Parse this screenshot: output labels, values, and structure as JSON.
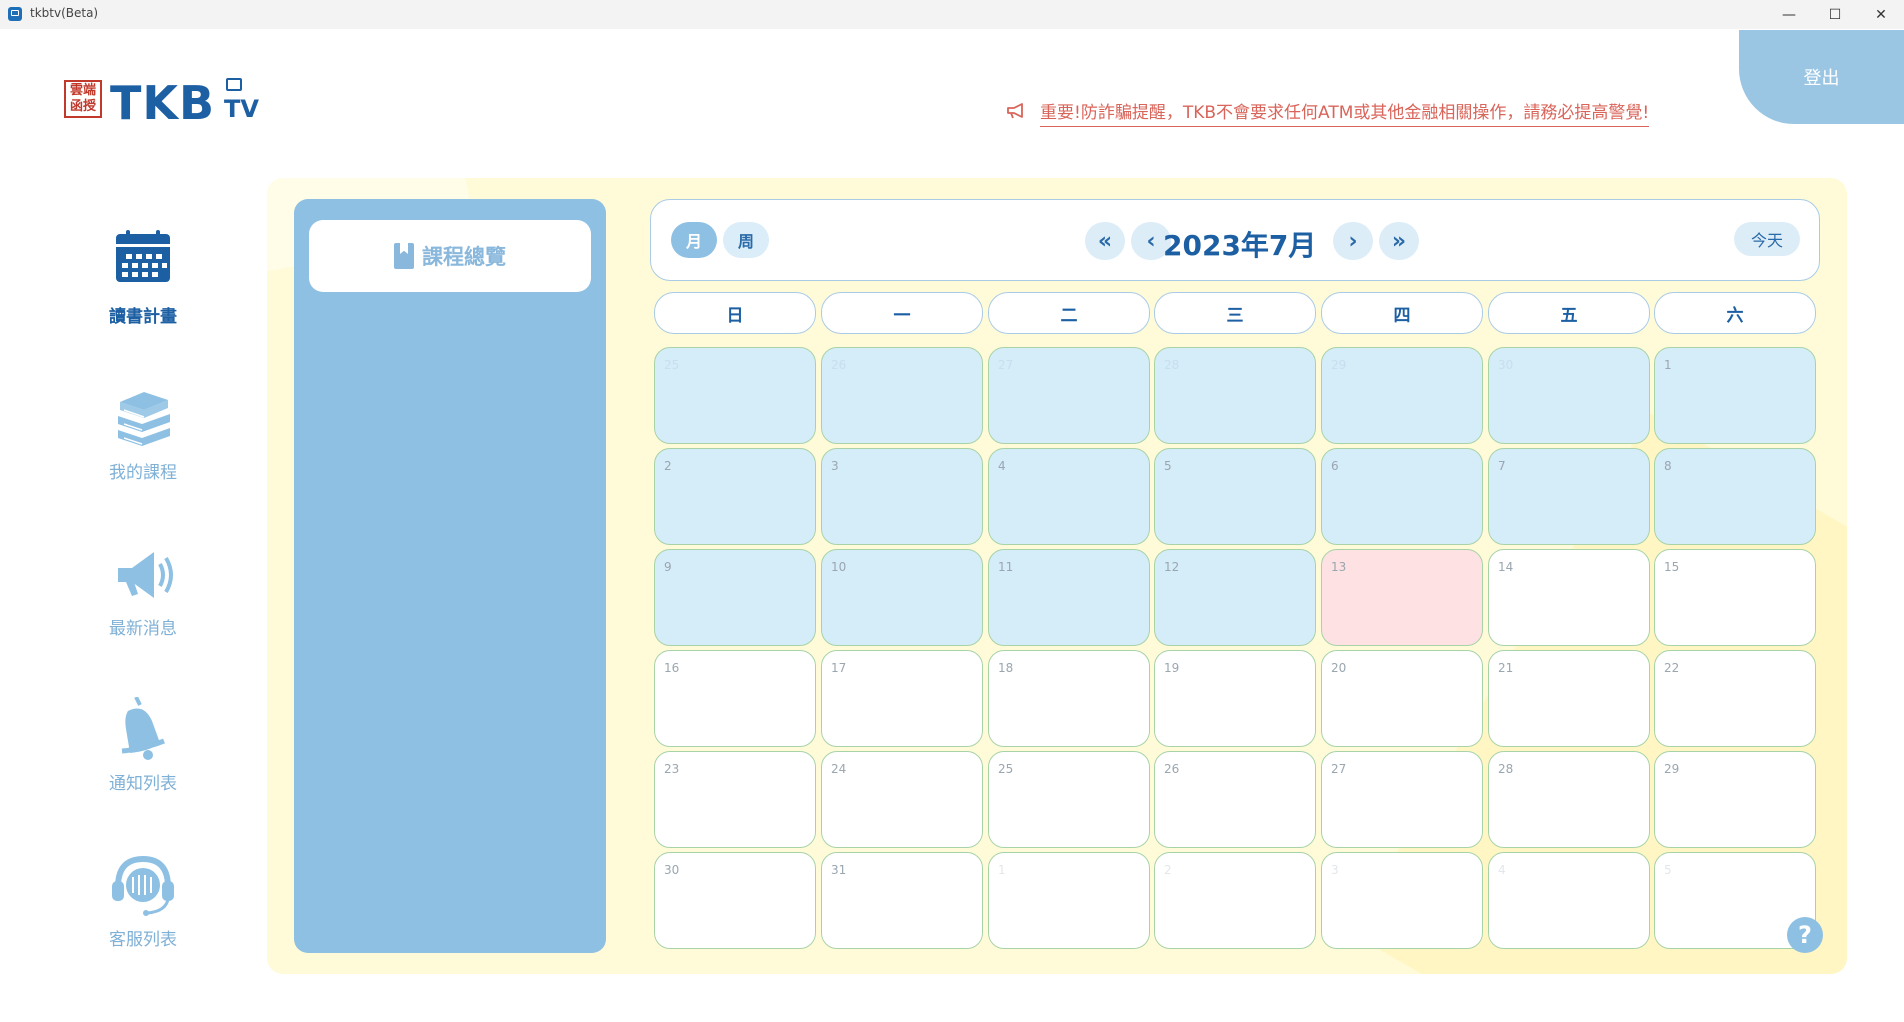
{
  "window": {
    "title": "tkbtv(Beta)",
    "minimize": "—",
    "maximize": "☐",
    "close": "✕"
  },
  "logo": {
    "seal": "雲端\n函授",
    "brand": "TKB",
    "brand_suffix": "TV"
  },
  "header": {
    "logout": "登出",
    "notice": "重要!防詐騙提醒，TKB不會要求任何ATM或其他金融相關操作，請務必提高警覺!"
  },
  "nav": [
    {
      "label": "讀書計畫",
      "icon": "calendar-icon",
      "active": true
    },
    {
      "label": "我的課程",
      "icon": "books-icon"
    },
    {
      "label": "最新消息",
      "icon": "megaphone-icon"
    },
    {
      "label": "通知列表",
      "icon": "bell-icon"
    },
    {
      "label": "客服列表",
      "icon": "headset-icon"
    }
  ],
  "overview": {
    "label": "課程總覽",
    "icon": "bookmark-icon"
  },
  "calendar": {
    "view_month": "月",
    "view_week": "周",
    "prev_year": "«",
    "prev_month": "‹",
    "title": "2023年7月",
    "next_month": "›",
    "next_year": "»",
    "today": "今天",
    "weekdays": [
      "日",
      "一",
      "二",
      "三",
      "四",
      "五",
      "六"
    ],
    "days": [
      {
        "n": "25",
        "state": "past",
        "other": true
      },
      {
        "n": "26",
        "state": "past",
        "other": true
      },
      {
        "n": "27",
        "state": "past",
        "other": true
      },
      {
        "n": "28",
        "state": "past",
        "other": true
      },
      {
        "n": "29",
        "state": "past",
        "other": true
      },
      {
        "n": "30",
        "state": "past",
        "other": true
      },
      {
        "n": "1",
        "state": "past",
        "other": false
      },
      {
        "n": "2",
        "state": "past",
        "other": false
      },
      {
        "n": "3",
        "state": "past",
        "other": false
      },
      {
        "n": "4",
        "state": "past",
        "other": false
      },
      {
        "n": "5",
        "state": "past",
        "other": false
      },
      {
        "n": "6",
        "state": "past",
        "other": false
      },
      {
        "n": "7",
        "state": "past",
        "other": false
      },
      {
        "n": "8",
        "state": "past",
        "other": false
      },
      {
        "n": "9",
        "state": "past",
        "other": false
      },
      {
        "n": "10",
        "state": "past",
        "other": false
      },
      {
        "n": "11",
        "state": "past",
        "other": false
      },
      {
        "n": "12",
        "state": "past",
        "other": false
      },
      {
        "n": "13",
        "state": "today",
        "other": false
      },
      {
        "n": "14",
        "state": "future",
        "other": false
      },
      {
        "n": "15",
        "state": "future",
        "other": false
      },
      {
        "n": "16",
        "state": "future",
        "other": false
      },
      {
        "n": "17",
        "state": "future",
        "other": false
      },
      {
        "n": "18",
        "state": "future",
        "other": false
      },
      {
        "n": "19",
        "state": "future",
        "other": false
      },
      {
        "n": "20",
        "state": "future",
        "other": false
      },
      {
        "n": "21",
        "state": "future",
        "other": false
      },
      {
        "n": "22",
        "state": "future",
        "other": false
      },
      {
        "n": "23",
        "state": "future",
        "other": false
      },
      {
        "n": "24",
        "state": "future",
        "other": false
      },
      {
        "n": "25",
        "state": "future",
        "other": false
      },
      {
        "n": "26",
        "state": "future",
        "other": false
      },
      {
        "n": "27",
        "state": "future",
        "other": false
      },
      {
        "n": "28",
        "state": "future",
        "other": false
      },
      {
        "n": "29",
        "state": "future",
        "other": false
      },
      {
        "n": "30",
        "state": "future",
        "other": false
      },
      {
        "n": "31",
        "state": "future",
        "other": false
      },
      {
        "n": "1",
        "state": "future",
        "other": true
      },
      {
        "n": "2",
        "state": "future",
        "other": true
      },
      {
        "n": "3",
        "state": "future",
        "other": true
      },
      {
        "n": "4",
        "state": "future",
        "other": true
      },
      {
        "n": "5",
        "state": "future",
        "other": true
      }
    ]
  },
  "help": "?"
}
